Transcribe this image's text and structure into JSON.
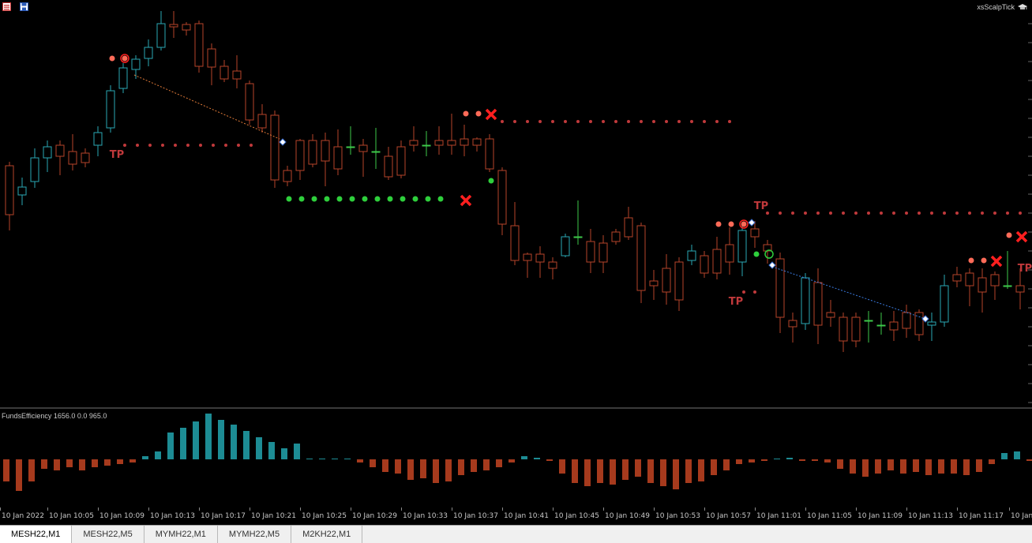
{
  "window": {
    "brand": "xsScalpTick",
    "indicator_label": "FundsEfficiency 1656.0 0.0 965.0"
  },
  "colors": {
    "bull": "#2aa7b4",
    "bear": "#b6442a",
    "doji": "#3ec94a",
    "tp_dot": "#c0393b",
    "tp_text": "#c0393b",
    "entry_dot": "#ff6b58",
    "green_dot": "#2ecf3c",
    "cross": "#ff1f1f",
    "hist_up": "#1d8c94",
    "hist_down": "#a63a1d"
  },
  "time_axis": {
    "labels": [
      "10 Jan 2022",
      "10 Jan 10:05",
      "10 Jan 10:09",
      "10 Jan 10:13",
      "10 Jan 10:17",
      "10 Jan 10:21",
      "10 Jan 10:25",
      "10 Jan 10:29",
      "10 Jan 10:33",
      "10 Jan 10:37",
      "10 Jan 10:41",
      "10 Jan 10:45",
      "10 Jan 10:49",
      "10 Jan 10:53",
      "10 Jan 10:57",
      "10 Jan 11:01",
      "10 Jan 11:05",
      "10 Jan 11:09",
      "10 Jan 11:13",
      "10 Jan 11:17",
      "10 Jan"
    ]
  },
  "tp_label": "TP",
  "tabs": [
    {
      "label": "MESH22,M1",
      "active": true
    },
    {
      "label": "MESH22,M5",
      "active": false
    },
    {
      "label": "MYMH22,M1",
      "active": false
    },
    {
      "label": "MYMH22,M5",
      "active": false
    },
    {
      "label": "M2KH22,M1",
      "active": false
    }
  ]
}
